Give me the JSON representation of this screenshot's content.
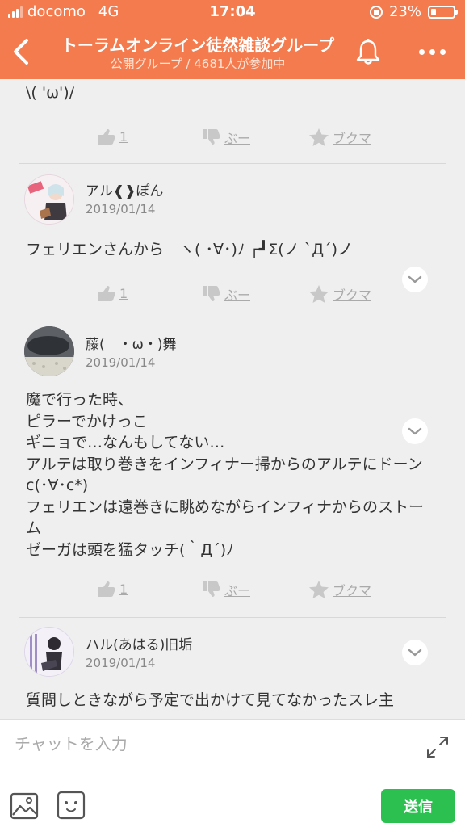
{
  "status_bar": {
    "carrier": "docomo",
    "network": "4G",
    "time": "17:04",
    "battery_text": "23%",
    "battery_level": 0.23
  },
  "header": {
    "title": "トーラムオンライン徒然雑談グループ",
    "subtitle": "公開グループ / 4681人が参加中",
    "accent_color": "#f47b4e"
  },
  "actions_labels": {
    "like_icon": "thumbs-up-icon",
    "dislike_label": "ぶー",
    "bookmark_label": "ブクマ"
  },
  "posts": [
    {
      "text": "\\( 'ω')/",
      "likes": "1",
      "dislike_label": "ぶー",
      "bookmark_label": "ブクマ"
    },
    {
      "username": "アル❰❱ぽん",
      "date": "2019/01/14",
      "text": "フェリエンさんから　ヽ( ･∀･)ﾉ ┌┛Σ(ノ `Д´)ノ",
      "likes": "1",
      "dislike_label": "ぶー",
      "bookmark_label": "ブクマ"
    },
    {
      "username": "藤(　・ω・)舞",
      "date": "2019/01/14",
      "text": "魔で行った時、\nピラーでかけっこ\nギニョで…なんもしてない…\nアルテは取り巻きをインフィナー掃からのアルテにドーンc(･∀･c*)\nフェリエンは遠巻きに眺めながらインフィナからのストーム\nゼーガは頭を猛タッチ(｀Д´)ﾉ",
      "likes": "1",
      "dislike_label": "ぶー",
      "bookmark_label": "ブクマ"
    },
    {
      "username": "ハル(あはる)旧垢",
      "date": "2019/01/14",
      "text": "質問しときながら予定で出かけて見てなかったスレ主"
    }
  ],
  "input_bar": {
    "placeholder": "チャットを入力",
    "send_label": "送信",
    "send_color": "#2bc04f"
  }
}
